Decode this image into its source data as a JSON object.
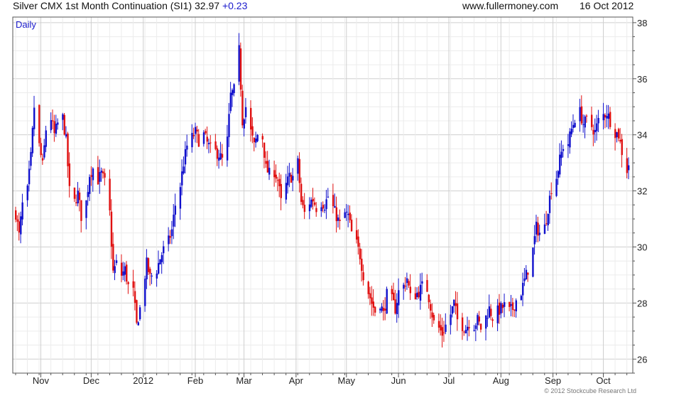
{
  "header": {
    "title": "Silver CMX 1st Month Continuation (SI1)",
    "last": "32.97",
    "change": "+0.23",
    "site": "www.fullermoney.com",
    "date": "16 Oct 2012"
  },
  "frequency_label": "Daily",
  "copyright": "© 2012 Stockcube Research Ltd",
  "colors": {
    "up": "#1010cc",
    "down": "#e01010",
    "grid": "#d8d8d8",
    "frame": "#555555"
  },
  "chart_data": {
    "type": "ohlc",
    "title": "Silver CMX 1st Month Continuation (SI1)",
    "yaxis_position": "right",
    "ylim": [
      25.5,
      38.2
    ],
    "yticks": [
      26,
      28,
      30,
      32,
      34,
      36,
      38
    ],
    "xlim": [
      "2011-10-17",
      "2012-10-16"
    ],
    "xticks": [
      {
        "label": "Nov",
        "date": "2011-11-01"
      },
      {
        "label": "Dec",
        "date": "2011-12-01"
      },
      {
        "label": "2012",
        "date": "2012-01-01"
      },
      {
        "label": "Feb",
        "date": "2012-02-01"
      },
      {
        "label": "Mar",
        "date": "2012-03-01"
      },
      {
        "label": "Apr",
        "date": "2012-04-01"
      },
      {
        "label": "May",
        "date": "2012-05-01"
      },
      {
        "label": "Jun",
        "date": "2012-06-01"
      },
      {
        "label": "Jul",
        "date": "2012-07-01"
      },
      {
        "label": "Aug",
        "date": "2012-08-01"
      },
      {
        "label": "Sep",
        "date": "2012-09-01"
      },
      {
        "label": "Oct",
        "date": "2012-10-01"
      }
    ],
    "grid": true,
    "close_path": [
      [
        "2011-10-17",
        31.2
      ],
      [
        "2011-10-19",
        30.4
      ],
      [
        "2011-10-21",
        31.5
      ],
      [
        "2011-10-24",
        32.0
      ],
      [
        "2011-10-26",
        33.2
      ],
      [
        "2011-10-28",
        35.0
      ],
      [
        "2011-10-31",
        33.6
      ],
      [
        "2011-11-02",
        32.9
      ],
      [
        "2011-11-04",
        34.2
      ],
      [
        "2011-11-07",
        34.6
      ],
      [
        "2011-11-09",
        34.0
      ],
      [
        "2011-11-11",
        34.4
      ],
      [
        "2011-11-14",
        34.6
      ],
      [
        "2011-11-16",
        33.8
      ],
      [
        "2011-11-18",
        32.0
      ],
      [
        "2011-11-21",
        31.6
      ],
      [
        "2011-11-23",
        31.9
      ],
      [
        "2011-11-25",
        31.1
      ],
      [
        "2011-11-28",
        31.6
      ],
      [
        "2011-11-30",
        32.6
      ],
      [
        "2011-12-02",
        32.8
      ],
      [
        "2011-12-05",
        32.4
      ],
      [
        "2011-12-07",
        32.6
      ],
      [
        "2011-12-09",
        32.3
      ],
      [
        "2011-12-12",
        31.2
      ],
      [
        "2011-12-14",
        29.1
      ],
      [
        "2011-12-16",
        29.4
      ],
      [
        "2011-12-19",
        29.0
      ],
      [
        "2011-12-21",
        29.2
      ],
      [
        "2011-12-23",
        28.6
      ],
      [
        "2011-12-26",
        28.4
      ],
      [
        "2011-12-28",
        27.2
      ],
      [
        "2011-12-30",
        27.8
      ],
      [
        "2012-01-03",
        29.4
      ],
      [
        "2012-01-05",
        28.9
      ],
      [
        "2012-01-09",
        29.2
      ],
      [
        "2012-01-11",
        29.6
      ],
      [
        "2012-01-13",
        29.9
      ],
      [
        "2012-01-16",
        30.2
      ],
      [
        "2012-01-18",
        30.6
      ],
      [
        "2012-01-20",
        31.5
      ],
      [
        "2012-01-23",
        32.2
      ],
      [
        "2012-01-25",
        33.0
      ],
      [
        "2012-01-27",
        33.6
      ],
      [
        "2012-01-30",
        33.9
      ],
      [
        "2012-02-01",
        34.1
      ],
      [
        "2012-02-03",
        33.8
      ],
      [
        "2012-02-06",
        34.0
      ],
      [
        "2012-02-08",
        33.7
      ],
      [
        "2012-02-10",
        33.5
      ],
      [
        "2012-02-13",
        33.4
      ],
      [
        "2012-02-15",
        33.3
      ],
      [
        "2012-02-17",
        33.1
      ],
      [
        "2012-02-20",
        33.8
      ],
      [
        "2012-02-22",
        35.4
      ],
      [
        "2012-02-24",
        35.6
      ],
      [
        "2012-02-27",
        37.0
      ],
      [
        "2012-02-29",
        34.5
      ],
      [
        "2012-03-02",
        35.0
      ],
      [
        "2012-03-05",
        34.1
      ],
      [
        "2012-03-07",
        33.6
      ],
      [
        "2012-03-09",
        34.0
      ],
      [
        "2012-03-12",
        33.9
      ],
      [
        "2012-03-14",
        32.8
      ],
      [
        "2012-03-16",
        32.6
      ],
      [
        "2012-03-19",
        32.7
      ],
      [
        "2012-03-21",
        32.4
      ],
      [
        "2012-03-23",
        31.6
      ],
      [
        "2012-03-26",
        32.2
      ],
      [
        "2012-03-28",
        32.5
      ],
      [
        "2012-03-30",
        32.5
      ],
      [
        "2012-04-02",
        33.0
      ],
      [
        "2012-04-04",
        31.6
      ],
      [
        "2012-04-06",
        31.2
      ],
      [
        "2012-04-09",
        31.6
      ],
      [
        "2012-04-11",
        31.7
      ],
      [
        "2012-04-13",
        31.4
      ],
      [
        "2012-04-16",
        31.6
      ],
      [
        "2012-04-18",
        31.5
      ],
      [
        "2012-04-20",
        31.8
      ],
      [
        "2012-04-23",
        31.4
      ],
      [
        "2012-04-25",
        31.1
      ],
      [
        "2012-04-27",
        30.8
      ],
      [
        "2012-04-30",
        31.2
      ],
      [
        "2012-05-02",
        31.1
      ],
      [
        "2012-05-04",
        30.5
      ],
      [
        "2012-05-07",
        30.1
      ],
      [
        "2012-05-09",
        29.7
      ],
      [
        "2012-05-11",
        29.0
      ],
      [
        "2012-05-14",
        28.4
      ],
      [
        "2012-05-16",
        28.0
      ],
      [
        "2012-05-18",
        27.7
      ],
      [
        "2012-05-21",
        28.0
      ],
      [
        "2012-05-23",
        27.6
      ],
      [
        "2012-05-25",
        28.3
      ],
      [
        "2012-05-28",
        28.1
      ],
      [
        "2012-05-30",
        27.8
      ],
      [
        "2012-06-01",
        28.4
      ],
      [
        "2012-06-04",
        28.6
      ],
      [
        "2012-06-06",
        28.9
      ],
      [
        "2012-06-08",
        28.2
      ],
      [
        "2012-06-11",
        28.3
      ],
      [
        "2012-06-13",
        28.4
      ],
      [
        "2012-06-15",
        28.6
      ],
      [
        "2012-06-18",
        28.5
      ],
      [
        "2012-06-20",
        27.9
      ],
      [
        "2012-06-22",
        27.3
      ],
      [
        "2012-06-25",
        27.1
      ],
      [
        "2012-06-27",
        26.9
      ],
      [
        "2012-06-29",
        27.2
      ],
      [
        "2012-07-02",
        27.6
      ],
      [
        "2012-07-04",
        28.0
      ],
      [
        "2012-07-06",
        27.4
      ],
      [
        "2012-07-09",
        27.2
      ],
      [
        "2012-07-11",
        27.1
      ],
      [
        "2012-07-13",
        27.3
      ],
      [
        "2012-07-16",
        27.2
      ],
      [
        "2012-07-18",
        27.4
      ],
      [
        "2012-07-20",
        27.1
      ],
      [
        "2012-07-23",
        27.5
      ],
      [
        "2012-07-25",
        27.8
      ],
      [
        "2012-07-27",
        27.5
      ],
      [
        "2012-07-30",
        27.7
      ],
      [
        "2012-08-01",
        27.8
      ],
      [
        "2012-08-03",
        27.9
      ],
      [
        "2012-08-06",
        27.7
      ],
      [
        "2012-08-08",
        27.8
      ],
      [
        "2012-08-10",
        28.1
      ],
      [
        "2012-08-13",
        28.4
      ],
      [
        "2012-08-15",
        28.8
      ],
      [
        "2012-08-17",
        29.2
      ],
      [
        "2012-08-20",
        29.9
      ],
      [
        "2012-08-22",
        30.7
      ],
      [
        "2012-08-24",
        30.5
      ],
      [
        "2012-08-27",
        30.7
      ],
      [
        "2012-08-29",
        31.4
      ],
      [
        "2012-08-31",
        32.1
      ],
      [
        "2012-09-03",
        32.5
      ],
      [
        "2012-09-05",
        33.1
      ],
      [
        "2012-09-07",
        33.6
      ],
      [
        "2012-09-10",
        33.7
      ],
      [
        "2012-09-12",
        34.2
      ],
      [
        "2012-09-14",
        34.6
      ],
      [
        "2012-09-17",
        34.8
      ],
      [
        "2012-09-19",
        34.4
      ],
      [
        "2012-09-21",
        34.5
      ],
      [
        "2012-09-24",
        34.3
      ],
      [
        "2012-09-26",
        34.1
      ],
      [
        "2012-09-28",
        34.5
      ],
      [
        "2012-10-01",
        34.7
      ],
      [
        "2012-10-03",
        34.8
      ],
      [
        "2012-10-05",
        34.5
      ],
      [
        "2012-10-08",
        34.1
      ],
      [
        "2012-10-10",
        34.0
      ],
      [
        "2012-10-12",
        33.4
      ],
      [
        "2012-10-15",
        32.74
      ],
      [
        "2012-10-16",
        32.97
      ]
    ]
  }
}
